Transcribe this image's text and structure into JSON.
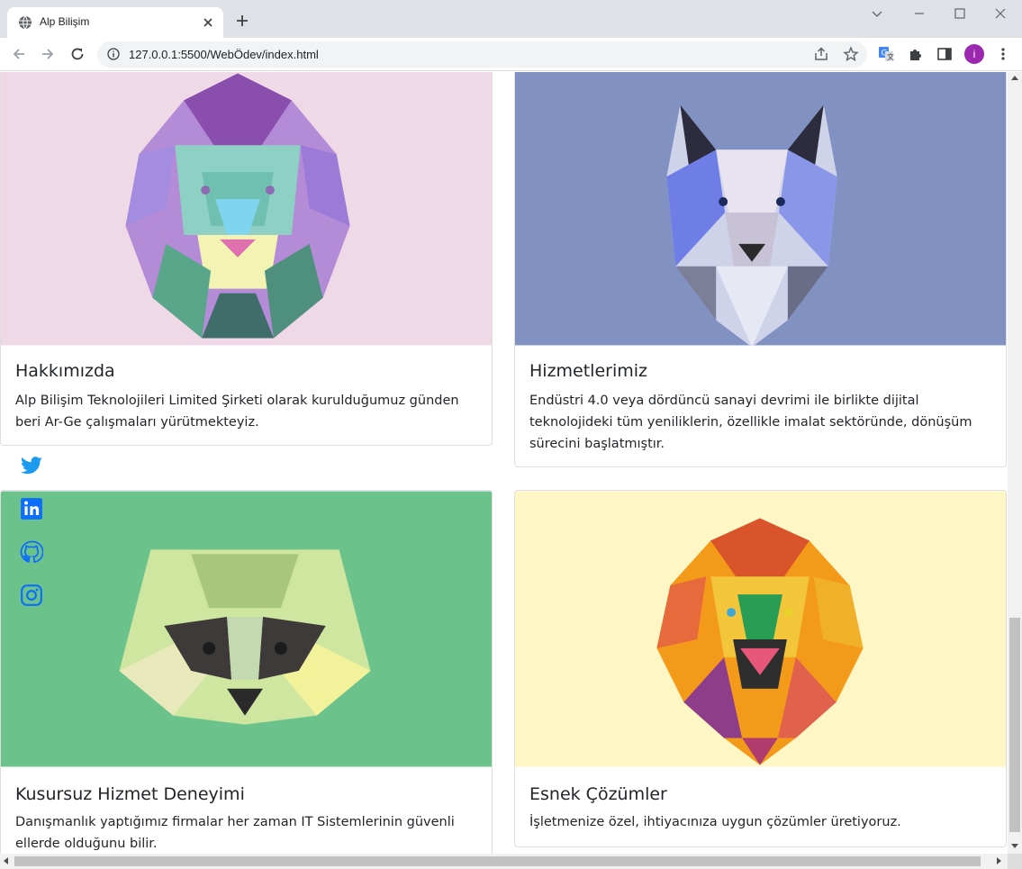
{
  "browser": {
    "tab": {
      "title": "Alp Bilişim",
      "favicon": "globe-icon"
    },
    "url": "127.0.0.1:5500/WebÖdev/index.html",
    "profile_initial": "i"
  },
  "cards": [
    {
      "title": "Hakkımızda",
      "text": "Alp Bilişim Teknolojileri Limited Şirketi olarak kurulduğumuz günden beri Ar-Ge çalışmaları yürütmekteyiz.",
      "image": "polygonal-lion-purple",
      "bg": "#f0d9e7"
    },
    {
      "title": "Hizmetlerimiz",
      "text": "Endüstri 4.0 veya dördüncü sanayi devrimi ile birlikte dijital teknolojideki tüm yeniliklerin, özellikle imalat sektöründe, dönüşüm sürecini başlatmıştır.",
      "image": "polygonal-wolf",
      "bg": "#8091c2"
    },
    {
      "title": "Kusursuz Hizmet Deneyimi",
      "text": "Danışmanlık yaptığımız firmalar her zaman IT Sistemlerinin güvenli ellerde olduğunu bilir.",
      "image": "polygonal-raccoon",
      "bg": "#6cc28b"
    },
    {
      "title": "Esnek Çözümler",
      "text": "İşletmenize özel, ihtiyacınıza uygun çözümler üretiyoruz.",
      "image": "polygonal-lion-orange",
      "bg": "#fff6c6"
    }
  ],
  "social": [
    "twitter-icon",
    "linkedin-icon",
    "github-icon",
    "instagram-icon"
  ],
  "colors": {
    "social_blue": "#1d9bf0",
    "link_blue": "#0d6efd"
  }
}
